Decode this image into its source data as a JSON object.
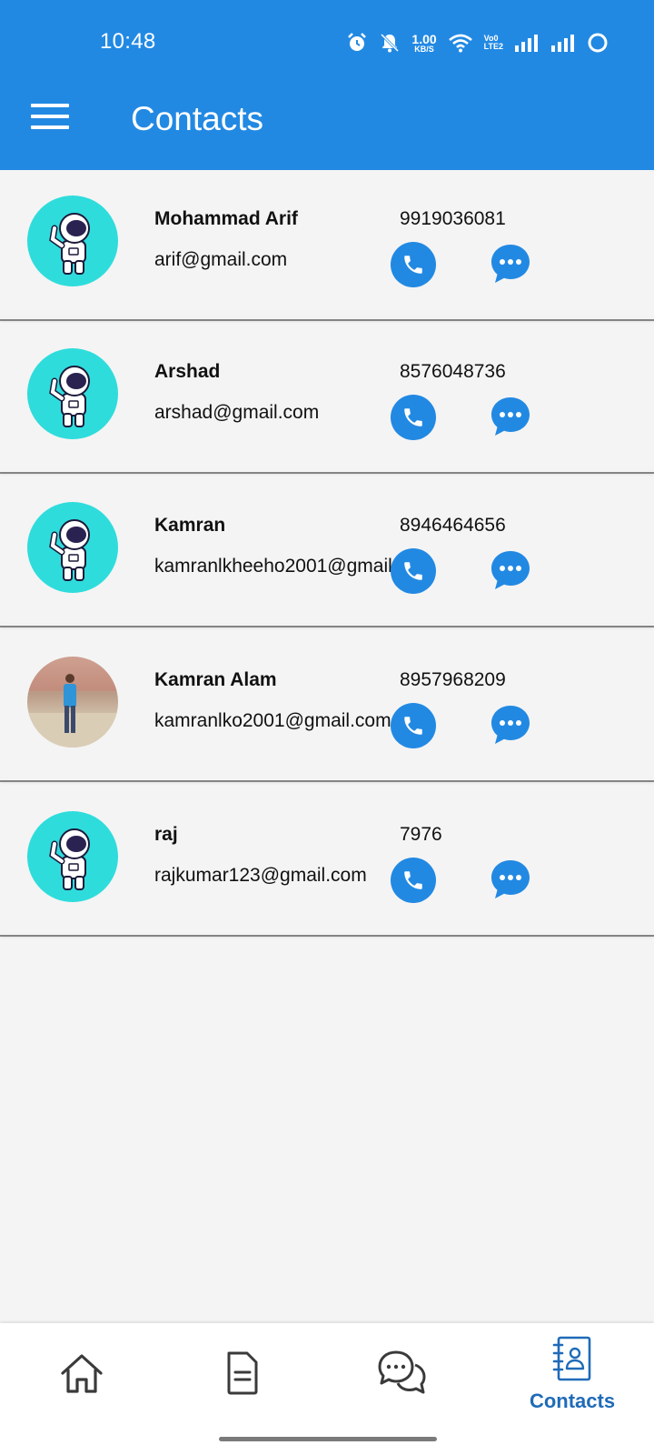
{
  "status_bar": {
    "time": "10:48",
    "net_speed_value": "1.00",
    "net_speed_unit": "KB/S",
    "volte_line1": "Vo0",
    "volte_line2": "LTE2"
  },
  "header": {
    "title": "Contacts"
  },
  "contacts": [
    {
      "name": "Mohammad Arif",
      "email": "arif@gmail.com",
      "phone": "9919036081",
      "avatar": "astronaut-avatar"
    },
    {
      "name": "Arshad",
      "email": "arshad@gmail.com",
      "phone": "8576048736",
      "avatar": "astronaut-avatar"
    },
    {
      "name": "Kamran",
      "email": "kamranlkheeho2001@gmail.com",
      "phone": "8946464656",
      "avatar": "astronaut-avatar"
    },
    {
      "name": "Kamran Alam",
      "email": "kamranlko2001@gmail.com",
      "phone": "8957968209",
      "avatar": "photo-avatar"
    },
    {
      "name": "raj",
      "email": "rajkumar123@gmail.com",
      "phone": "7976",
      "avatar": "astronaut-avatar"
    }
  ],
  "bottom_nav": {
    "items": [
      {
        "icon": "home-icon",
        "label": ""
      },
      {
        "icon": "document-icon",
        "label": ""
      },
      {
        "icon": "chat-icon",
        "label": ""
      },
      {
        "icon": "contacts-book-icon",
        "label": "Contacts",
        "active": true
      }
    ]
  },
  "colors": {
    "primary": "#2289e3",
    "active_nav": "#1f6bb8",
    "avatar_bg": "#2fdcdc",
    "background": "#f4f4f4"
  }
}
